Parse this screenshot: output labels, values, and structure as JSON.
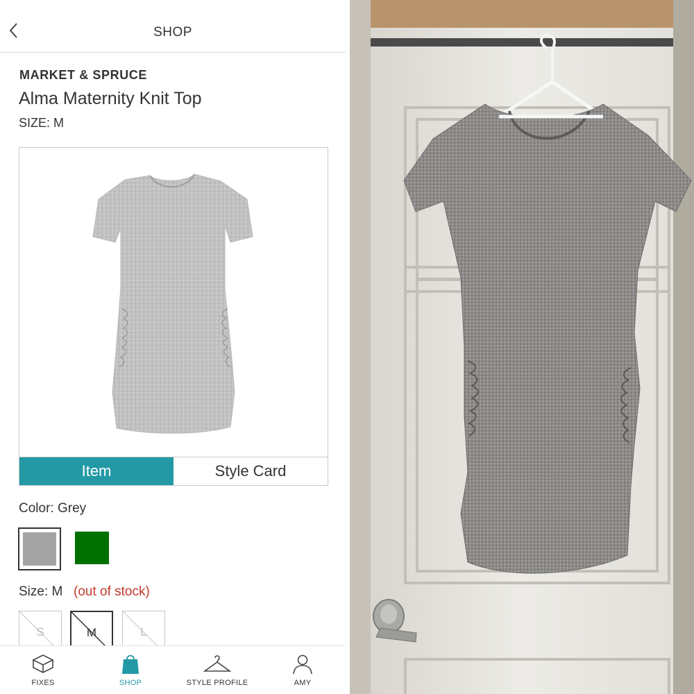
{
  "header": {
    "title": "SHOP"
  },
  "product": {
    "brand": "MARKET & SPRUCE",
    "name": "Alma Maternity Knit Top",
    "size_line": "SIZE: M"
  },
  "tabs": [
    {
      "label": "Item",
      "active": true
    },
    {
      "label": "Style Card",
      "active": false
    }
  ],
  "color": {
    "label": "Color: Grey",
    "swatches": [
      {
        "name": "grey",
        "hex": "#a4a4a4",
        "selected": true
      },
      {
        "name": "green",
        "hex": "#007000",
        "selected": false
      }
    ]
  },
  "size": {
    "label": "Size: M",
    "stock_note": "(out of stock)",
    "options": [
      {
        "label": "S",
        "selected": false
      },
      {
        "label": "M",
        "selected": true
      },
      {
        "label": "L",
        "selected": false
      }
    ]
  },
  "bottom_nav": [
    {
      "label": "FIXES",
      "icon": "box-icon",
      "active": false
    },
    {
      "label": "SHOP",
      "icon": "shopping-bag-icon",
      "active": true
    },
    {
      "label": "STYLE PROFILE",
      "icon": "hanger-icon",
      "active": false
    },
    {
      "label": "AMY",
      "icon": "person-icon",
      "active": false
    }
  ],
  "colors": {
    "accent": "#2399a6",
    "alert": "#c0392b",
    "text": "#333333"
  }
}
